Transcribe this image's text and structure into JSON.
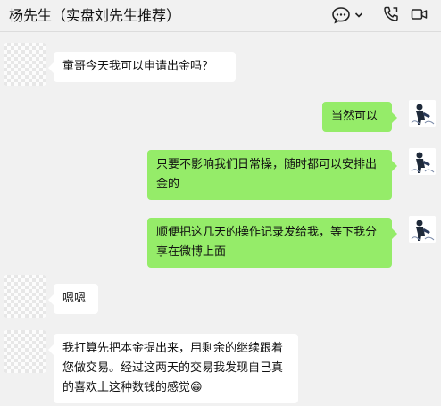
{
  "header": {
    "title": "杨先生（实盘刘先生推荐）",
    "chat_icon": "chat-bubble-icon",
    "dropdown_icon": "chevron-down-icon",
    "call_icon": "phone-icon"
  },
  "colors": {
    "background": "#f1f1f1",
    "incoming_bubble": "#ffffff",
    "outgoing_bubble": "#95ec69"
  },
  "messages": [
    {
      "side": "incoming",
      "text": "童哥今天我可以申请出金吗？"
    },
    {
      "side": "outgoing",
      "text": "当然可以"
    },
    {
      "side": "outgoing",
      "text": "只要不影响我们日常操，随时都可以安排出金的"
    },
    {
      "side": "outgoing",
      "text": "顺便把这几天的操作记录发给我，等下我分享在微博上面"
    },
    {
      "side": "incoming",
      "text": "嗯嗯"
    },
    {
      "side": "incoming",
      "text": "我打算先把本金提出来，用剩余的继续跟着您做交易。经过这两天的交易我发现自己真的喜欢上这种数钱的感觉😁"
    }
  ]
}
